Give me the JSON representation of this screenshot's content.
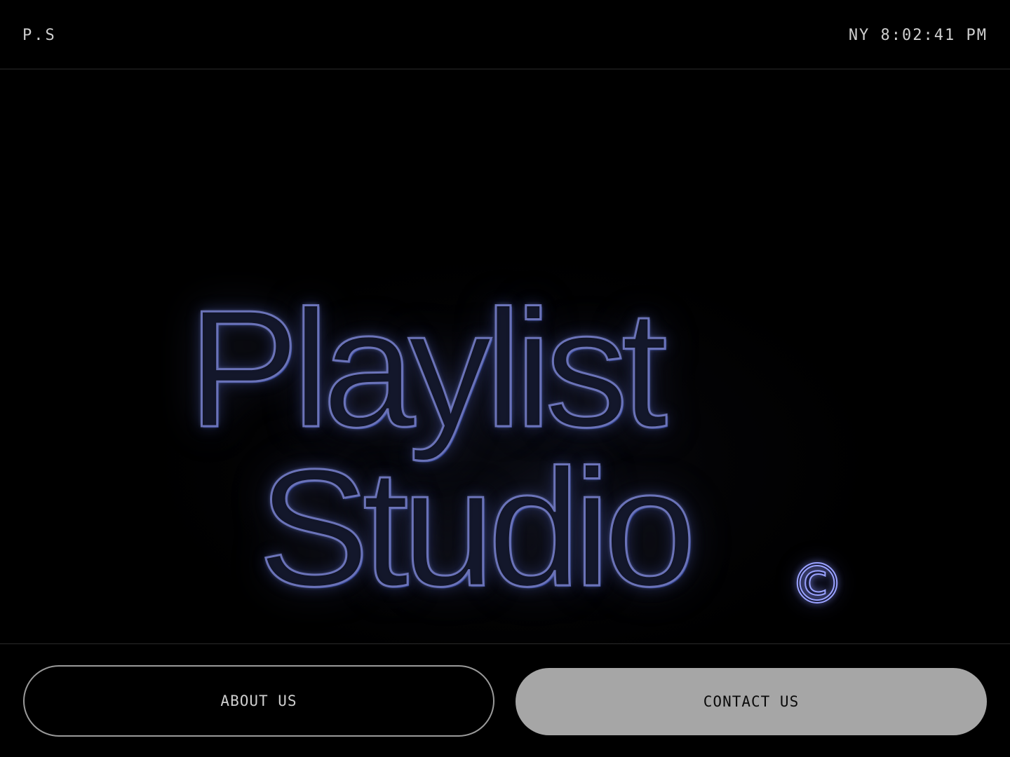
{
  "header": {
    "logo": "P.S",
    "clock": "NY 8:02:41 PM"
  },
  "hero": {
    "line1": "Playlist",
    "line2": "Studio",
    "mark": "©"
  },
  "actions": {
    "about_label": "ABOUT US",
    "contact_label": "CONTACT US"
  },
  "colors": {
    "background": "#000000",
    "contact_button_bg": "#a6a6a6",
    "glow_accent": "#6b73b8"
  }
}
